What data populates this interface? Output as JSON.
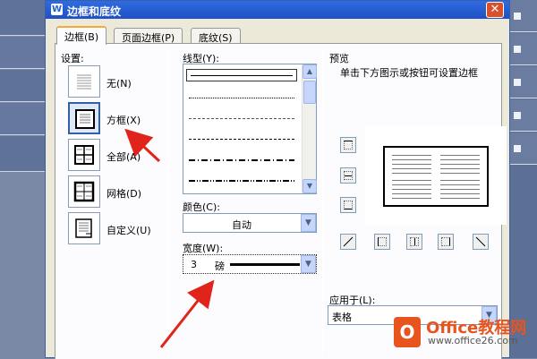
{
  "dialog": {
    "title": "边框和底纹",
    "title_icon": "W",
    "close_glyph": "✕"
  },
  "tabs": [
    {
      "label": "边框(B)",
      "active": true
    },
    {
      "label": "页面边框(P)",
      "active": false
    },
    {
      "label": "底纹(S)",
      "active": false
    }
  ],
  "settings": {
    "heading": "设置:",
    "items": [
      {
        "label": "无(N)",
        "icon": "none-border-icon",
        "selected": false
      },
      {
        "label": "方框(X)",
        "icon": "box-border-icon",
        "selected": true
      },
      {
        "label": "全部(A)",
        "icon": "all-border-icon",
        "selected": false
      },
      {
        "label": "网格(D)",
        "icon": "grid-border-icon",
        "selected": false
      },
      {
        "label": "自定义(U)",
        "icon": "custom-border-icon",
        "selected": false
      }
    ]
  },
  "line_style": {
    "heading": "线型(Y):",
    "styles": [
      "solid",
      "dotted",
      "dashed-fine",
      "dashed",
      "dash-dot",
      "dash-dot-dot"
    ]
  },
  "color": {
    "heading": "颜色(C):",
    "value": "自动"
  },
  "width": {
    "heading": "宽度(W):",
    "value": "3",
    "unit": "磅"
  },
  "preview": {
    "heading": "预览",
    "hint": "单击下方图示或按钮可设置边框"
  },
  "apply_to": {
    "heading": "应用于(L):",
    "value": "表格"
  },
  "watermark": {
    "logo_letter": "O",
    "title": "Office教程网",
    "url": "www.office26.com"
  },
  "colors": {
    "title_bar": "#2f6ce0",
    "dialog_bg": "#ece9d8",
    "arrow": "#e0241b",
    "brand": "#e8541e"
  }
}
